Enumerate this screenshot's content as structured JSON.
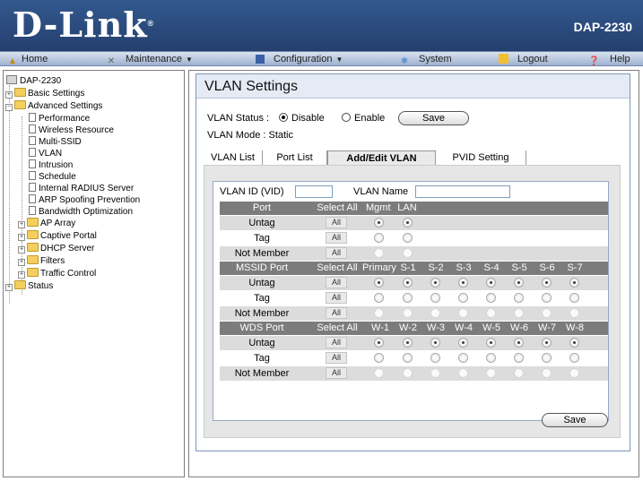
{
  "header": {
    "logo": "D-Link",
    "logo_mark": "®",
    "model": "DAP-2230"
  },
  "menu": {
    "home": "Home",
    "maintenance": "Maintenance",
    "configuration": "Configuration",
    "system": "System",
    "logout": "Logout",
    "help": "Help"
  },
  "sidebar": {
    "root": "DAP-2230",
    "basic": "Basic Settings",
    "advanced": "Advanced Settings",
    "adv_items": [
      "Performance",
      "Wireless Resource",
      "Multi-SSID",
      "VLAN",
      "Intrusion",
      "Schedule",
      "Internal RADIUS Server",
      "ARP Spoofing Prevention",
      "Bandwidth Optimization"
    ],
    "folders": [
      "AP Array",
      "Captive Portal",
      "DHCP Server",
      "Filters",
      "Traffic Control"
    ],
    "status": "Status"
  },
  "page": {
    "title": "VLAN Settings",
    "status_label": "VLAN Status :",
    "disable": "Disable",
    "enable": "Enable",
    "save": "Save",
    "mode_label": "VLAN Mode :",
    "mode_value": "Static",
    "tabs": [
      "VLAN List",
      "Port List",
      "Add/Edit VLAN",
      "PVID Setting"
    ]
  },
  "form": {
    "vid_label": "VLAN ID (VID)",
    "name_label": "VLAN Name",
    "all": "All",
    "row_labels": [
      "Untag",
      "Tag",
      "Not Member"
    ],
    "port": {
      "header": "Port",
      "select_all": "Select All",
      "cols": [
        "Mgmt",
        "LAN"
      ]
    },
    "mssid": {
      "header": "MSSID Port",
      "select_all": "Select All",
      "cols": [
        "Primary",
        "S-1",
        "S-2",
        "S-3",
        "S-4",
        "S-5",
        "S-6",
        "S-7"
      ]
    },
    "wds": {
      "header": "WDS Port",
      "select_all": "Select All",
      "cols": [
        "W-1",
        "W-2",
        "W-3",
        "W-4",
        "W-5",
        "W-6",
        "W-7",
        "W-8"
      ]
    },
    "save": "Save"
  }
}
